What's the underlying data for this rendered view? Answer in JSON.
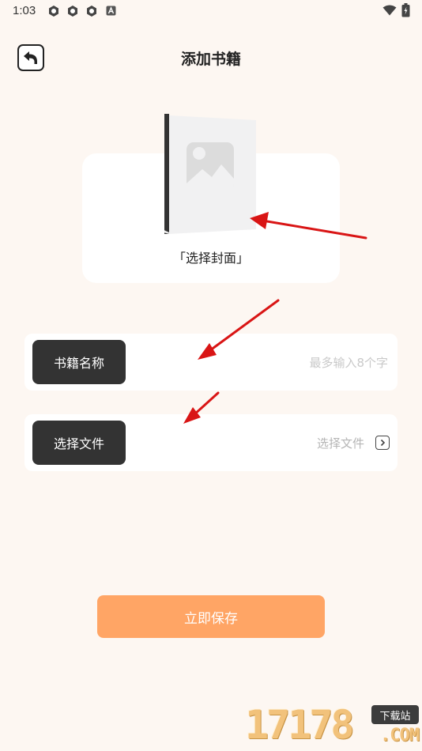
{
  "status_bar": {
    "time": "1:03",
    "notification_icons": [
      "app-icon",
      "app-icon",
      "app-icon",
      "a-icon"
    ],
    "system_icons": [
      "wifi-icon",
      "battery-icon"
    ]
  },
  "header": {
    "back_icon": "back-arrow-icon",
    "title": "添加书籍"
  },
  "cover": {
    "label": "「选择封面」",
    "placeholder_icon": "image-placeholder-icon"
  },
  "form": {
    "book_name": {
      "label": "书籍名称",
      "placeholder": "最多输入8个字"
    },
    "file": {
      "label": "选择文件",
      "value_text": "选择文件",
      "chevron_icon": "chevron-right-icon"
    }
  },
  "actions": {
    "save_label": "立即保存"
  },
  "watermark": {
    "digits": "17178",
    "badge": "下载站",
    "suffix": ".COM"
  },
  "colors": {
    "background": "#fdf7f2",
    "save_button": "#ffa565",
    "label_dark": "#333333",
    "annotation_arrow": "#d91515"
  }
}
